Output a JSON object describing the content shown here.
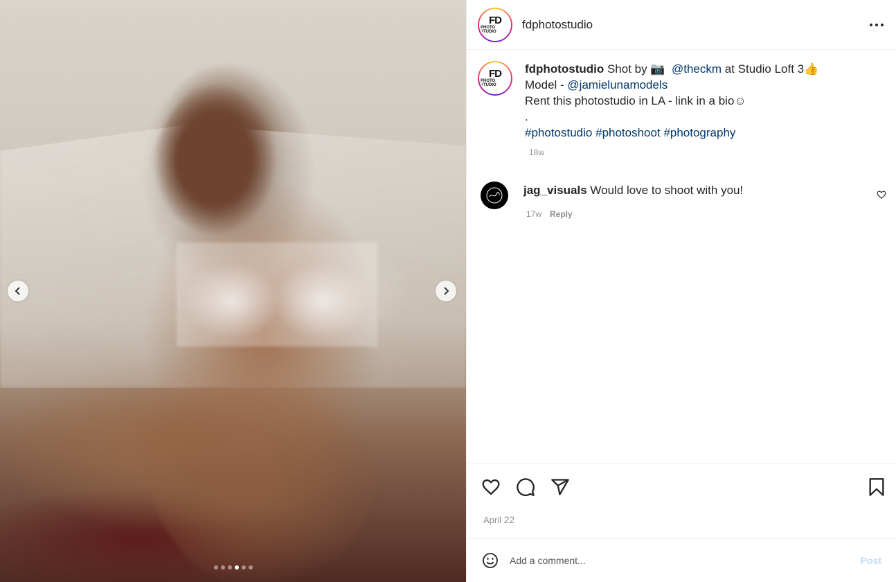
{
  "post": {
    "author": "fdphotostudio",
    "avatar_text_main": "FD",
    "avatar_text_sub": "PHOTO STUDIO",
    "caption_lines": {
      "line1_author": "fdphotostudio",
      "line1_text_a": " Shot by ",
      "camera_emoji": "📷",
      "mention1": "@theckm",
      "line1_text_b": " at Studio Loft 3",
      "thumbs_emoji": "👍",
      "line2_prefix": "Model - ",
      "mention2": "@jamielunamodels",
      "line3": "Rent this photostudio in LA - link in a bio",
      "smile_emoji": "☺",
      "line4": ".",
      "hashtag1": "#photostudio",
      "hashtag2": "#photoshoot",
      "hashtag3": "#photography"
    },
    "caption_time": "18w",
    "date_month": "April",
    "date_day": "22"
  },
  "comments": [
    {
      "user": "jag_visuals",
      "text": " Would love to shoot with you!",
      "time": "17w",
      "reply_label": "Reply"
    }
  ],
  "media": {
    "slide_count": 6,
    "active_slide": 4
  },
  "composer": {
    "placeholder": "Add a comment...",
    "post_label": "Post"
  },
  "icons": {
    "more": "more-options-icon",
    "like": "heart-icon",
    "comment": "comment-icon",
    "share": "share-icon",
    "save": "bookmark-icon",
    "emoji": "emoji-icon",
    "prev": "chevron-left-icon",
    "next": "chevron-right-icon"
  }
}
